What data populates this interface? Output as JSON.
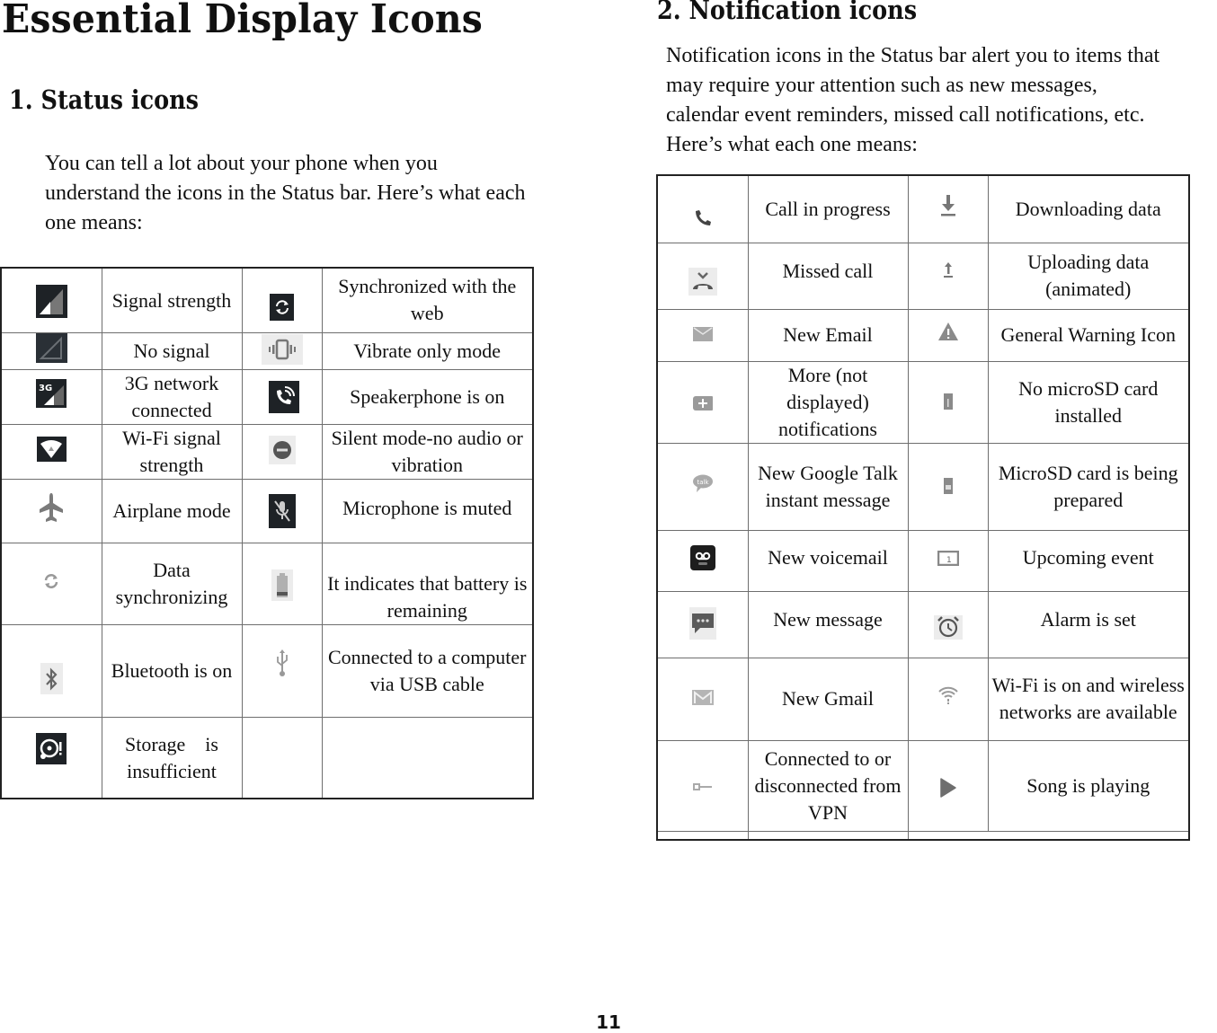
{
  "page": {
    "title": "Essential Display Icons",
    "page_number": "11"
  },
  "status_section": {
    "heading": "1. Status icons",
    "intro_lines": [
      "You can tell a lot about your phone when you",
      "understand the icons in the Status bar. Here’s what each",
      "one means:"
    ],
    "rows": [
      {
        "left": {
          "icon": "signal-strength-icon",
          "label": "Signal strength"
        },
        "right": {
          "icon": "sync-web-icon",
          "label": "Synchronized with the web"
        }
      },
      {
        "left": {
          "icon": "no-signal-icon",
          "label": "No signal"
        },
        "right": {
          "icon": "vibrate-icon",
          "label": "Vibrate only mode"
        }
      },
      {
        "left": {
          "icon": "3g-network-icon",
          "label": "3G network connected"
        },
        "right": {
          "icon": "speakerphone-icon",
          "label": "Speakerphone is on"
        }
      },
      {
        "left": {
          "icon": "wifi-signal-icon",
          "label": "Wi-Fi signal strength"
        },
        "right": {
          "icon": "silent-mode-icon",
          "label": "Silent mode-no audio or vibration"
        }
      },
      {
        "left": {
          "icon": "airplane-icon",
          "label": "Airplane mode"
        },
        "right": {
          "icon": "microphone-muted-icon",
          "label": "Microphone is muted"
        }
      },
      {
        "left": {
          "icon": "data-sync-icon",
          "label": "Data synchronizing"
        },
        "right": {
          "icon": "battery-icon",
          "label": "It indicates that battery is remaining"
        }
      },
      {
        "left": {
          "icon": "bluetooth-icon",
          "label": "Bluetooth is on"
        },
        "right": {
          "icon": "usb-icon",
          "label": "Connected to a computer via USB cable"
        }
      },
      {
        "left": {
          "icon": "storage-warning-icon",
          "label": "Storage    is insufficient"
        },
        "right": {
          "icon": "",
          "label": ""
        }
      }
    ]
  },
  "notification_section": {
    "heading": "2. Notification icons",
    "intro_lines": [
      "Notification icons in the Status bar alert you to items that",
      "may require your attention such as new messages,",
      "calendar event reminders, missed call notifications, etc.",
      "Here’s what each one means:"
    ],
    "rows": [
      {
        "left": {
          "icon": "call-in-progress-icon",
          "label": "Call in progress"
        },
        "right": {
          "icon": "download-icon",
          "label": "Downloading data"
        }
      },
      {
        "left": {
          "icon": "missed-call-icon",
          "label": "Missed call"
        },
        "right": {
          "icon": "upload-icon",
          "label": "Uploading data (animated)"
        }
      },
      {
        "left": {
          "icon": "email-icon",
          "label": "New Email"
        },
        "right": {
          "icon": "warning-icon",
          "label": "General Warning Icon"
        }
      },
      {
        "left": {
          "icon": "more-notifications-icon",
          "label": "More (not displayed) notifications"
        },
        "right": {
          "icon": "no-sd-card-icon",
          "label": "No microSD card installed"
        }
      },
      {
        "left": {
          "icon": "google-talk-icon",
          "label": "New Google Talk instant message"
        },
        "right": {
          "icon": "sd-card-preparing-icon",
          "label": "MicroSD card is being prepared"
        }
      },
      {
        "left": {
          "icon": "voicemail-icon",
          "label": "New voicemail"
        },
        "right": {
          "icon": "calendar-event-icon",
          "label": "Upcoming event"
        }
      },
      {
        "left": {
          "icon": "new-message-icon",
          "label": "New message"
        },
        "right": {
          "icon": "alarm-icon",
          "label": "Alarm is set"
        }
      },
      {
        "left": {
          "icon": "gmail-icon",
          "label": "New Gmail"
        },
        "right": {
          "icon": "wifi-available-icon",
          "label": "Wi-Fi is on and wireless networks are available"
        }
      },
      {
        "left": {
          "icon": "vpn-icon",
          "label": "Connected to or disconnected from VPN"
        },
        "right": {
          "icon": "play-icon",
          "label": "Song is playing"
        }
      }
    ]
  }
}
